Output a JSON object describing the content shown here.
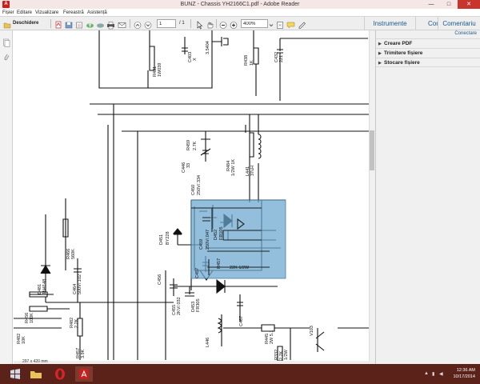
{
  "window": {
    "title": "BUNZ - Chassis YH2166C1.pdf - Adobe Reader",
    "minimize": "—",
    "maximize": "□",
    "close": "✕"
  },
  "menu": [
    "Fișier",
    "Editare",
    "Vizualizare",
    "Fereastră",
    "Asistență"
  ],
  "toolbar": {
    "open_label": "Deschidere",
    "page_current": "1",
    "page_total": "/ 1",
    "zoom": "400%",
    "tabs": [
      "Instrumente",
      "Completare & semnare",
      "Comentariu"
    ]
  },
  "right_panel": {
    "connect_label": "Conectare",
    "items": [
      "Creare PDF",
      "Trimitere fișiere",
      "Stocare fișiere"
    ]
  },
  "status": {
    "page_size": "297 x 420 mm"
  },
  "taskbar": {
    "time": "12:36 AM",
    "date": "10/17/2014"
  },
  "schematic": {
    "labels": [
      {
        "t": "R431"
      },
      {
        "t": "1W039"
      },
      {
        "t": "C403"
      },
      {
        "t": "X"
      },
      {
        "t": "3.5404"
      },
      {
        "t": "R438"
      },
      {
        "t": "1K"
      },
      {
        "t": "C432"
      },
      {
        "t": "221"
      },
      {
        "t": "R459"
      },
      {
        "t": "2.7K"
      },
      {
        "t": "C446"
      },
      {
        "t": "33"
      },
      {
        "t": "R484"
      },
      {
        "t": "1/2W 1K"
      },
      {
        "t": "L441"
      },
      {
        "t": "37uH"
      },
      {
        "t": "C450"
      },
      {
        "t": "250V/.334"
      },
      {
        "t": "D451"
      },
      {
        "t": "BY228"
      },
      {
        "t": "D452"
      },
      {
        "t": "FR105"
      },
      {
        "t": "C459"
      },
      {
        "t": "250V/.047"
      },
      {
        "t": "R457"
      },
      {
        "t": "22K 1/2W"
      },
      {
        "t": "C457"
      },
      {
        "t": "C456"
      },
      {
        "t": "R466"
      },
      {
        "t": "560K"
      },
      {
        "t": "D481"
      },
      {
        "t": "1N4148"
      },
      {
        "t": "C464"
      },
      {
        "t": "500V/.102"
      },
      {
        "t": "R456"
      },
      {
        "t": "100K"
      },
      {
        "t": "R482"
      },
      {
        "t": "2.2K"
      },
      {
        "t": "R482"
      },
      {
        "t": "10K"
      },
      {
        "t": "R457"
      },
      {
        "t": "3.9K"
      },
      {
        "t": "C455"
      },
      {
        "t": "2KV/.032"
      },
      {
        "t": "D453"
      },
      {
        "t": "FR305"
      },
      {
        "t": "C467"
      },
      {
        "t": "L446"
      },
      {
        "t": "R445"
      },
      {
        "t": "2W 5.1"
      },
      {
        "t": "V103"
      },
      {
        "t": "R332"
      },
      {
        "t": "2.7K"
      },
      {
        "t": "1/2W"
      }
    ]
  },
  "colors": {
    "selection_fill": "#6aa6cf",
    "taskbar": "#5a2219",
    "link_blue": "#1d5a8c"
  }
}
